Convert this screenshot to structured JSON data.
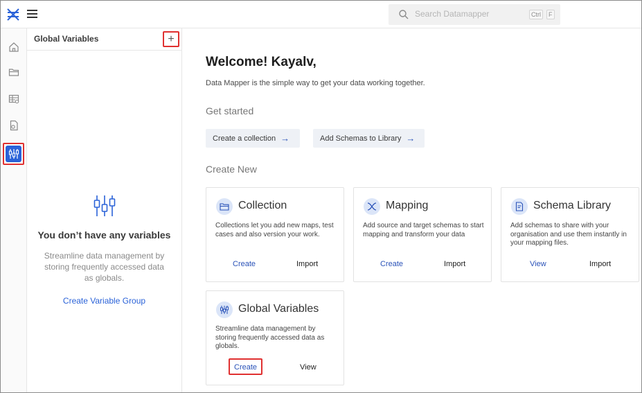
{
  "topbar": {
    "search_placeholder": "Search Datamapper",
    "shortcut_ctrl": "Ctrl",
    "shortcut_key": "F"
  },
  "rail": {
    "items": [
      "home-icon",
      "folder-icon",
      "table-icon",
      "file-icon",
      "global-variables-icon"
    ],
    "active": "global-variables-icon"
  },
  "panel": {
    "title": "Global Variables",
    "add_label": "+",
    "empty_title": "You don’t have any variables",
    "empty_desc": "Streamline data management by storing frequently accessed data as globals.",
    "empty_link": "Create Variable Group"
  },
  "main": {
    "welcome": "Welcome! Kayalv,",
    "tagline": "Data Mapper is the simple way to get your data working together.",
    "get_started": "Get started",
    "pills": [
      "Create a collection",
      "Add Schemas to Library"
    ],
    "create_new": "Create New",
    "cards": [
      {
        "title": "Collection",
        "desc": "Collections let you add new maps, test cases and also version your work.",
        "action1": "Create",
        "action2": "Import"
      },
      {
        "title": "Mapping",
        "desc": "Add source and target schemas to start mapping and transform your data",
        "action1": "Create",
        "action2": "Import"
      },
      {
        "title": "Schema Library",
        "desc": "Add schemas to share with your organisation and use them instantly in your mapping files.",
        "action1": "View",
        "action2": "Import"
      },
      {
        "title": "Global Variables",
        "desc": "Streamline data management by storing frequently accessed data as globals.",
        "action1": "Create",
        "action2": "View"
      }
    ]
  },
  "colors": {
    "accent": "#2a62d8",
    "highlight": "#e03131",
    "pill_bg": "#eef1f6"
  }
}
